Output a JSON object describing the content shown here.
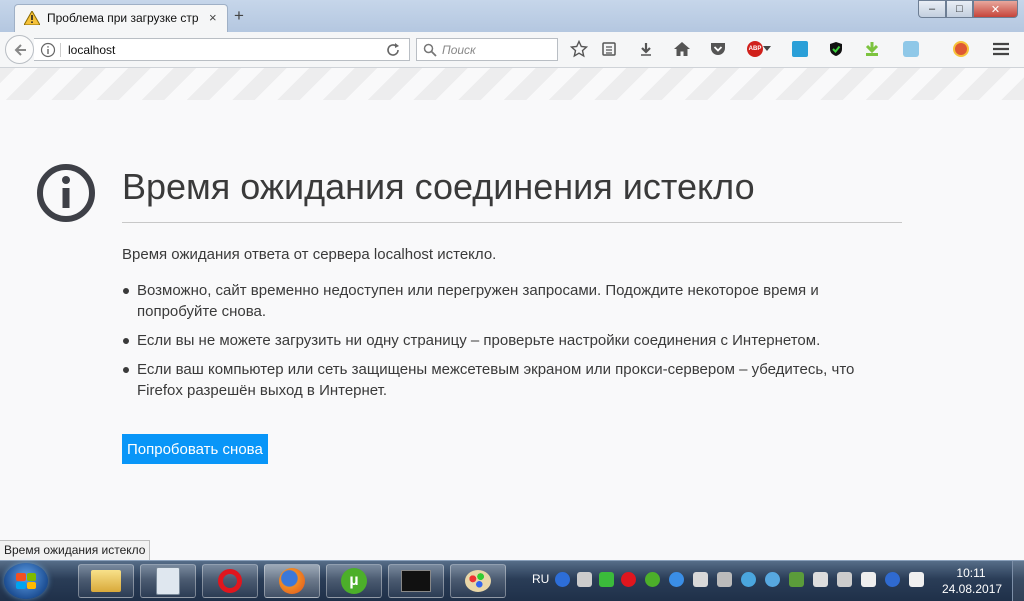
{
  "tab": {
    "title": "Проблема при загрузке стр",
    "close": "×",
    "new_tab": "+"
  },
  "window_controls": {
    "minimize": "–",
    "maximize": "□",
    "close": "✕"
  },
  "nav": {
    "url": "localhost",
    "search_placeholder": "Поиск",
    "toolbar_icons": [
      "bookmark-star-icon",
      "reading-list-icon",
      "download-icon",
      "home-icon",
      "pocket-icon",
      "adblock-plus-icon",
      "extension-icon",
      "shield-icon",
      "download-helper-icon",
      "skype-icon",
      "duckduckgo-icon",
      "menu-icon"
    ],
    "abp_label": "ABP"
  },
  "error": {
    "title": "Время ожидания соединения истекло",
    "description": "Время ожидания ответа от сервера localhost истекло.",
    "bullets": [
      "Возможно, сайт временно недоступен или перегружен запросами. Подождите некоторое время и попробуйте снова.",
      "Если вы не можете загрузить ни одну страницу – проверьте настройки соединения с Интернетом.",
      "Если ваш компьютер или сеть защищены межсетевым экраном или прокси-сервером – убедитесь, что Firefox разрешён выход в Интернет."
    ],
    "retry_button": "Попробовать снова"
  },
  "status_text": "Время ожидания истекло",
  "taskbar": {
    "apps": [
      "file-explorer",
      "calculator",
      "opera",
      "firefox",
      "utorrent",
      "command-prompt",
      "paint"
    ],
    "language": "RU",
    "time": "10:11",
    "date": "24.08.2017"
  },
  "colors": {
    "accent": "#0996f8",
    "text": "#3a3a3a",
    "page_bg": "#f9f9fa"
  }
}
